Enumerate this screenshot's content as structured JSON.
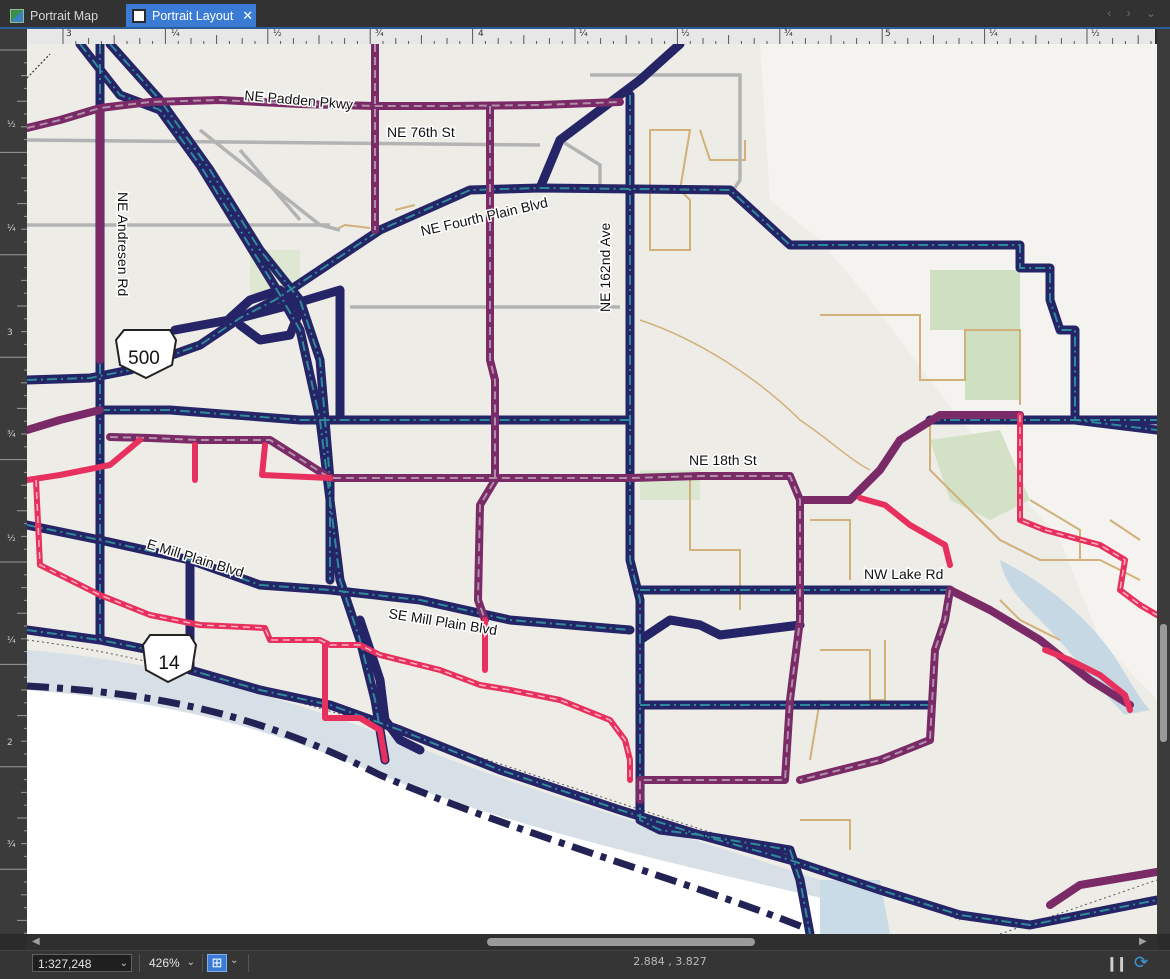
{
  "tabs": [
    {
      "label": "Portrait Map",
      "active": false
    },
    {
      "label": "Portrait Layout",
      "active": true
    }
  ],
  "icons": {
    "map_tab": "map-icon",
    "layout_tab": "layout-icon",
    "close": "close-icon",
    "refresh": "refresh-icon",
    "pause": "pause-icon",
    "grid": "grid-snap-icon"
  },
  "ruler": {
    "h_major": [
      "3",
      "4",
      "5"
    ],
    "h_minor": [
      "¼",
      "½",
      "¾"
    ],
    "v_major": [
      "3",
      "2"
    ],
    "v_minor": [
      "½",
      "¼",
      "¾"
    ]
  },
  "map": {
    "road_labels": [
      "NE Padden Pkwy",
      "NE 76th St",
      "NE Fourth Plain Blvd",
      "NE Andresen Rd",
      "NE 162nd Ave",
      "NE 18th St",
      "E Mill Plain Blvd",
      "SE Mill Plain Blvd",
      "NW Lake Rd"
    ],
    "shields": [
      "500",
      "14"
    ],
    "colors": {
      "base": "#eeece7",
      "water": "#c9dbe6",
      "park": "#d6e3c8",
      "boundary": "#d2b07a",
      "route_navy": "#242466",
      "route_teal": "#2e8a9a",
      "route_purple": "#7a2a66",
      "route_pink": "#e8305e",
      "street_gray": "#b3b3b3"
    }
  },
  "status": {
    "scale": "1:327,248",
    "zoom": "426%",
    "coords": "2.884 , 3.827"
  }
}
